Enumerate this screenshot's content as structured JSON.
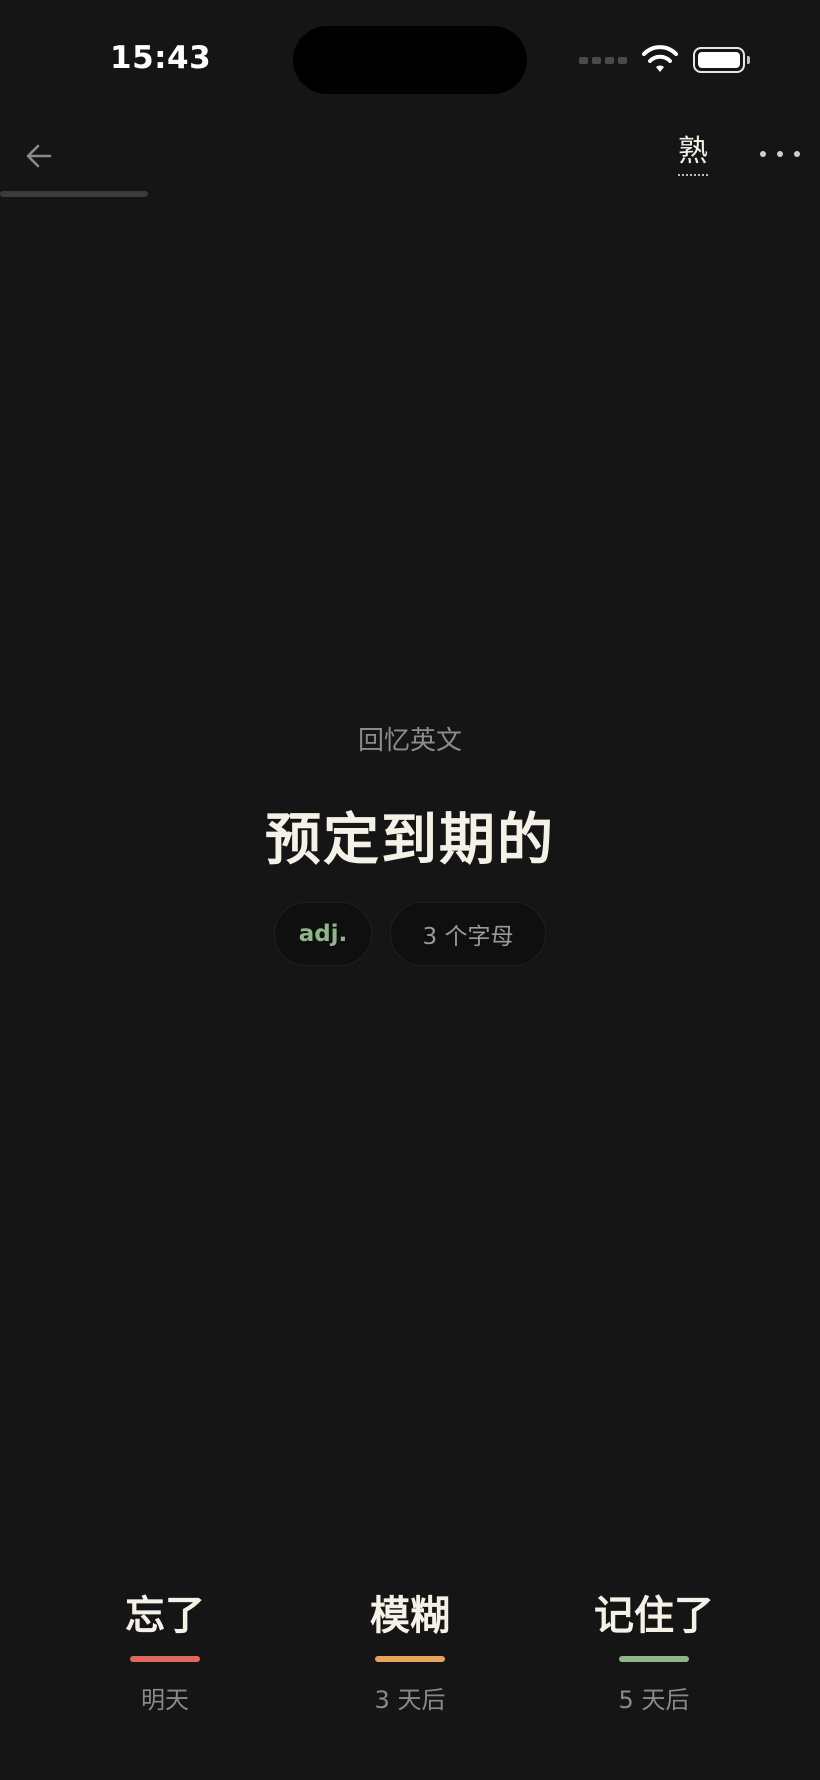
{
  "status_bar": {
    "time": "15:43"
  },
  "nav": {
    "familiar_label": "熟"
  },
  "progress": {
    "fraction": 0.18
  },
  "card": {
    "prompt": "回忆英文",
    "word": "预定到期的",
    "part_of_speech": "adj.",
    "letter_count": "3 个字母"
  },
  "actions": [
    {
      "label": "忘了",
      "interval": "明天",
      "color": "#e0675c"
    },
    {
      "label": "模糊",
      "interval": "3 天后",
      "color": "#e8a25a"
    },
    {
      "label": "记住了",
      "interval": "5 天后",
      "color": "#8fb58a"
    }
  ]
}
